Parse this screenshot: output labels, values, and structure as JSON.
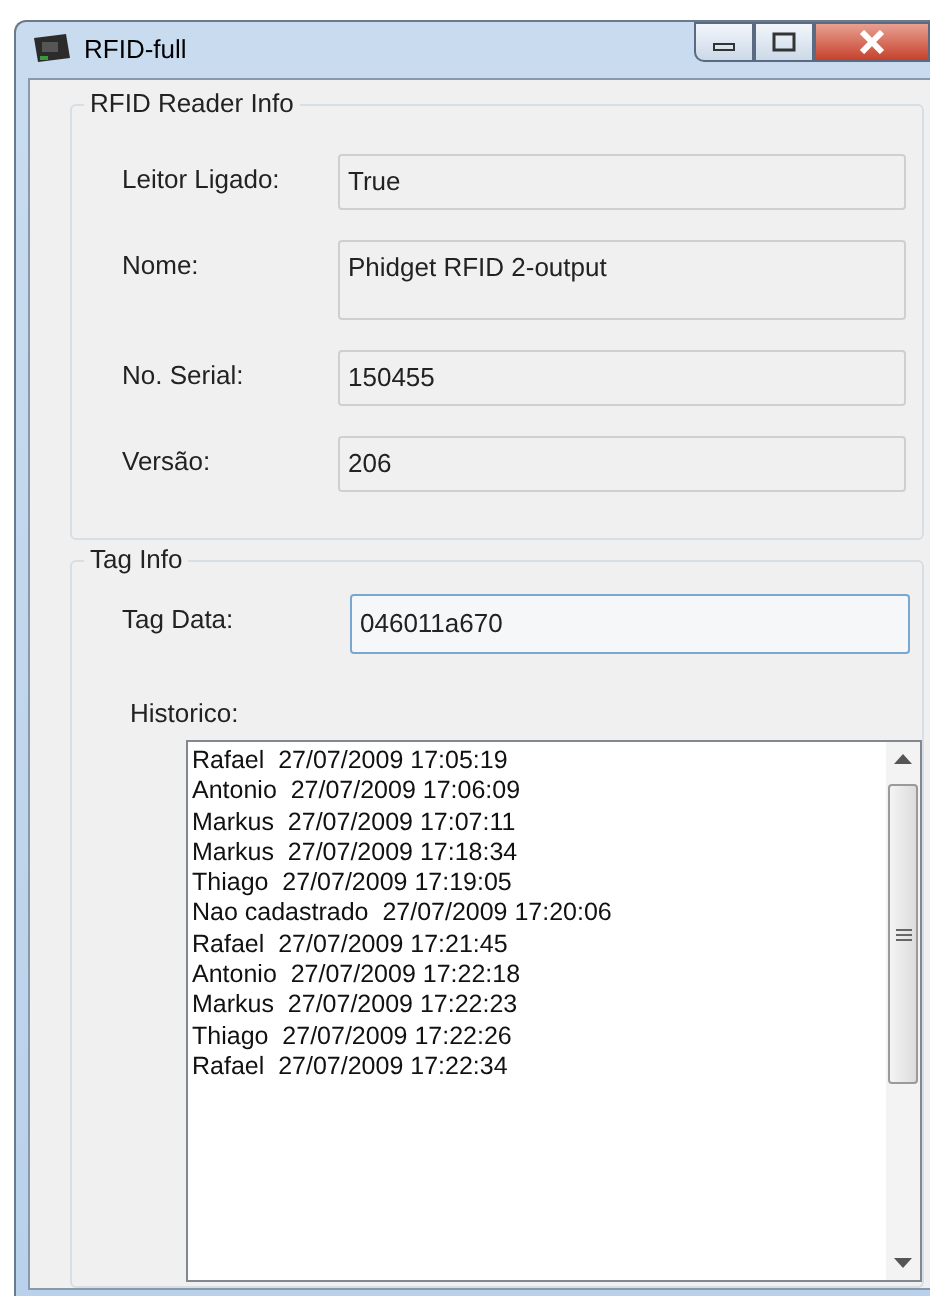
{
  "window": {
    "title": "RFID-full"
  },
  "reader_info": {
    "title": "RFID Reader Info",
    "fields": [
      {
        "label": "Leitor Ligado:",
        "value": "True",
        "kind": "short"
      },
      {
        "label": "Nome:",
        "value": "Phidget RFID 2-output",
        "kind": "tall"
      },
      {
        "label": "No. Serial:",
        "value": "150455",
        "kind": "short"
      },
      {
        "label": "Versão:",
        "value": "206",
        "kind": "short"
      }
    ]
  },
  "tag_info": {
    "title": "Tag Info",
    "tag_data": {
      "label": "Tag Data:",
      "value": "046011a670"
    },
    "historico": {
      "label": "Historico:",
      "items": [
        "Rafael  27/07/2009 17:05:19",
        "Antonio  27/07/2009 17:06:09",
        "Markus  27/07/2009 17:07:11",
        "Markus  27/07/2009 17:18:34",
        "Thiago  27/07/2009 17:19:05",
        "Nao cadastrado  27/07/2009 17:20:06",
        "Rafael  27/07/2009 17:21:45",
        "Antonio  27/07/2009 17:22:18",
        "Markus  27/07/2009 17:22:23",
        "Thiago  27/07/2009 17:22:26",
        "Rafael  27/07/2009 17:22:34"
      ]
    }
  }
}
